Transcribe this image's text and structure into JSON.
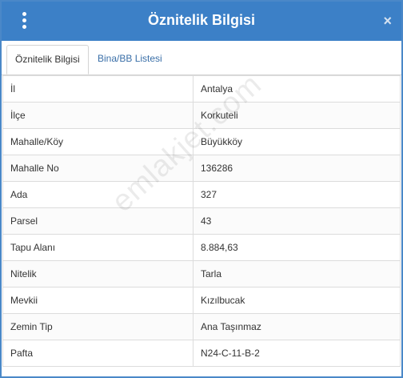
{
  "window": {
    "title": "Öznitelik Bilgisi",
    "close_symbol": "×"
  },
  "tabs": [
    {
      "label": "Öznitelik Bilgisi",
      "active": true
    },
    {
      "label": "Bina/BB Listesi",
      "active": false
    }
  ],
  "attributes": [
    {
      "key": "İl",
      "value": "Antalya"
    },
    {
      "key": "İlçe",
      "value": "Korkuteli"
    },
    {
      "key": "Mahalle/Köy",
      "value": "Büyükköy"
    },
    {
      "key": "Mahalle No",
      "value": "136286"
    },
    {
      "key": "Ada",
      "value": "327"
    },
    {
      "key": "Parsel",
      "value": "43"
    },
    {
      "key": "Tapu Alanı",
      "value": "8.884,63"
    },
    {
      "key": "Nitelik",
      "value": "Tarla"
    },
    {
      "key": "Mevkii",
      "value": "Kızılbucak"
    },
    {
      "key": "Zemin Tip",
      "value": "Ana Taşınmaz"
    },
    {
      "key": "Pafta",
      "value": "N24-C-11-B-2"
    }
  ],
  "watermark": "emlakjet.com",
  "colors": {
    "header": "#3c80c7",
    "tab_link": "#3a6fa8"
  },
  "icons": {
    "menu": "vertical-dots-icon",
    "close": "close-icon"
  }
}
